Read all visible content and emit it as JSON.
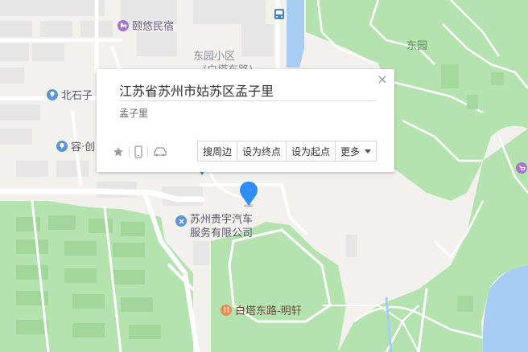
{
  "map": {
    "colors": {
      "background": "#f4f3ef",
      "green": "#b5e3b0",
      "water": "#a8cdf2",
      "road": "#ffffff",
      "building": "#e6e6e6"
    },
    "labels": {
      "yiyou_hotel": "颐悠民宿",
      "dongyuan_district": "东园小区",
      "dongyuan_district_sub": "(白塔东路)",
      "dongyuan_park": "东园",
      "beishi": "北石子",
      "rong": "容·创",
      "auto_company_line1": "苏州贵宇汽车",
      "auto_company_line2": "服务有限公司",
      "baita_mingxuan": "白塔东路-明轩"
    },
    "icons": {
      "hotel": "bed-icon",
      "poi_blue": "location-icon",
      "auto": "wrench-icon",
      "food": "restaurant-icon",
      "shop": "shopping-cart-icon",
      "bus": "bus-icon",
      "pin": "map-pin-icon"
    }
  },
  "popup": {
    "title": "江苏省苏州市姑苏区孟子里",
    "subtitle": "孟子里",
    "close_icon": "close-icon",
    "favorite_icon": "star-icon",
    "phone_icon": "phone-icon",
    "car_icon": "car-icon",
    "actions": {
      "nearby": "搜周边",
      "set_end": "设为终点",
      "set_start": "设为起点",
      "more": "更多"
    }
  }
}
